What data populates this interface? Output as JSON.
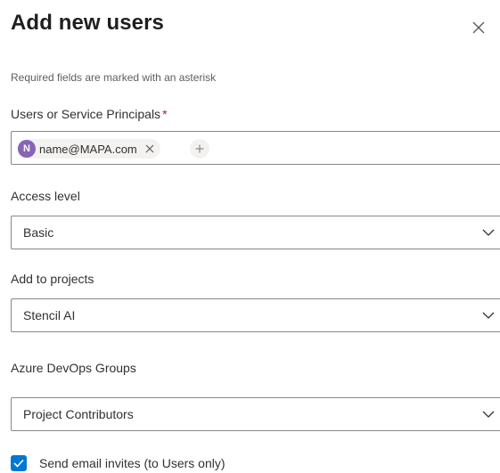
{
  "dialog": {
    "title": "Add new users",
    "required_note": "Required fields are marked with an asterisk",
    "close_icon": "close-icon"
  },
  "users_field": {
    "label": "Users or Service Principals",
    "required_marker": "*",
    "chips": [
      {
        "avatar_initial": "N",
        "avatar_color": "#8764b8",
        "text": "name@MAPA.com"
      }
    ],
    "add_icon": "plus-icon"
  },
  "access_level": {
    "label": "Access level",
    "value": "Basic"
  },
  "projects": {
    "label": "Add to projects",
    "value": "Stencil AI"
  },
  "groups": {
    "label": "Azure DevOps Groups",
    "value": "Project Contributors"
  },
  "send_invites": {
    "label": "Send email invites (to Users only)",
    "checked": true
  },
  "colors": {
    "accent": "#0078d4",
    "required": "#a4262c",
    "border": "#8a8886"
  }
}
